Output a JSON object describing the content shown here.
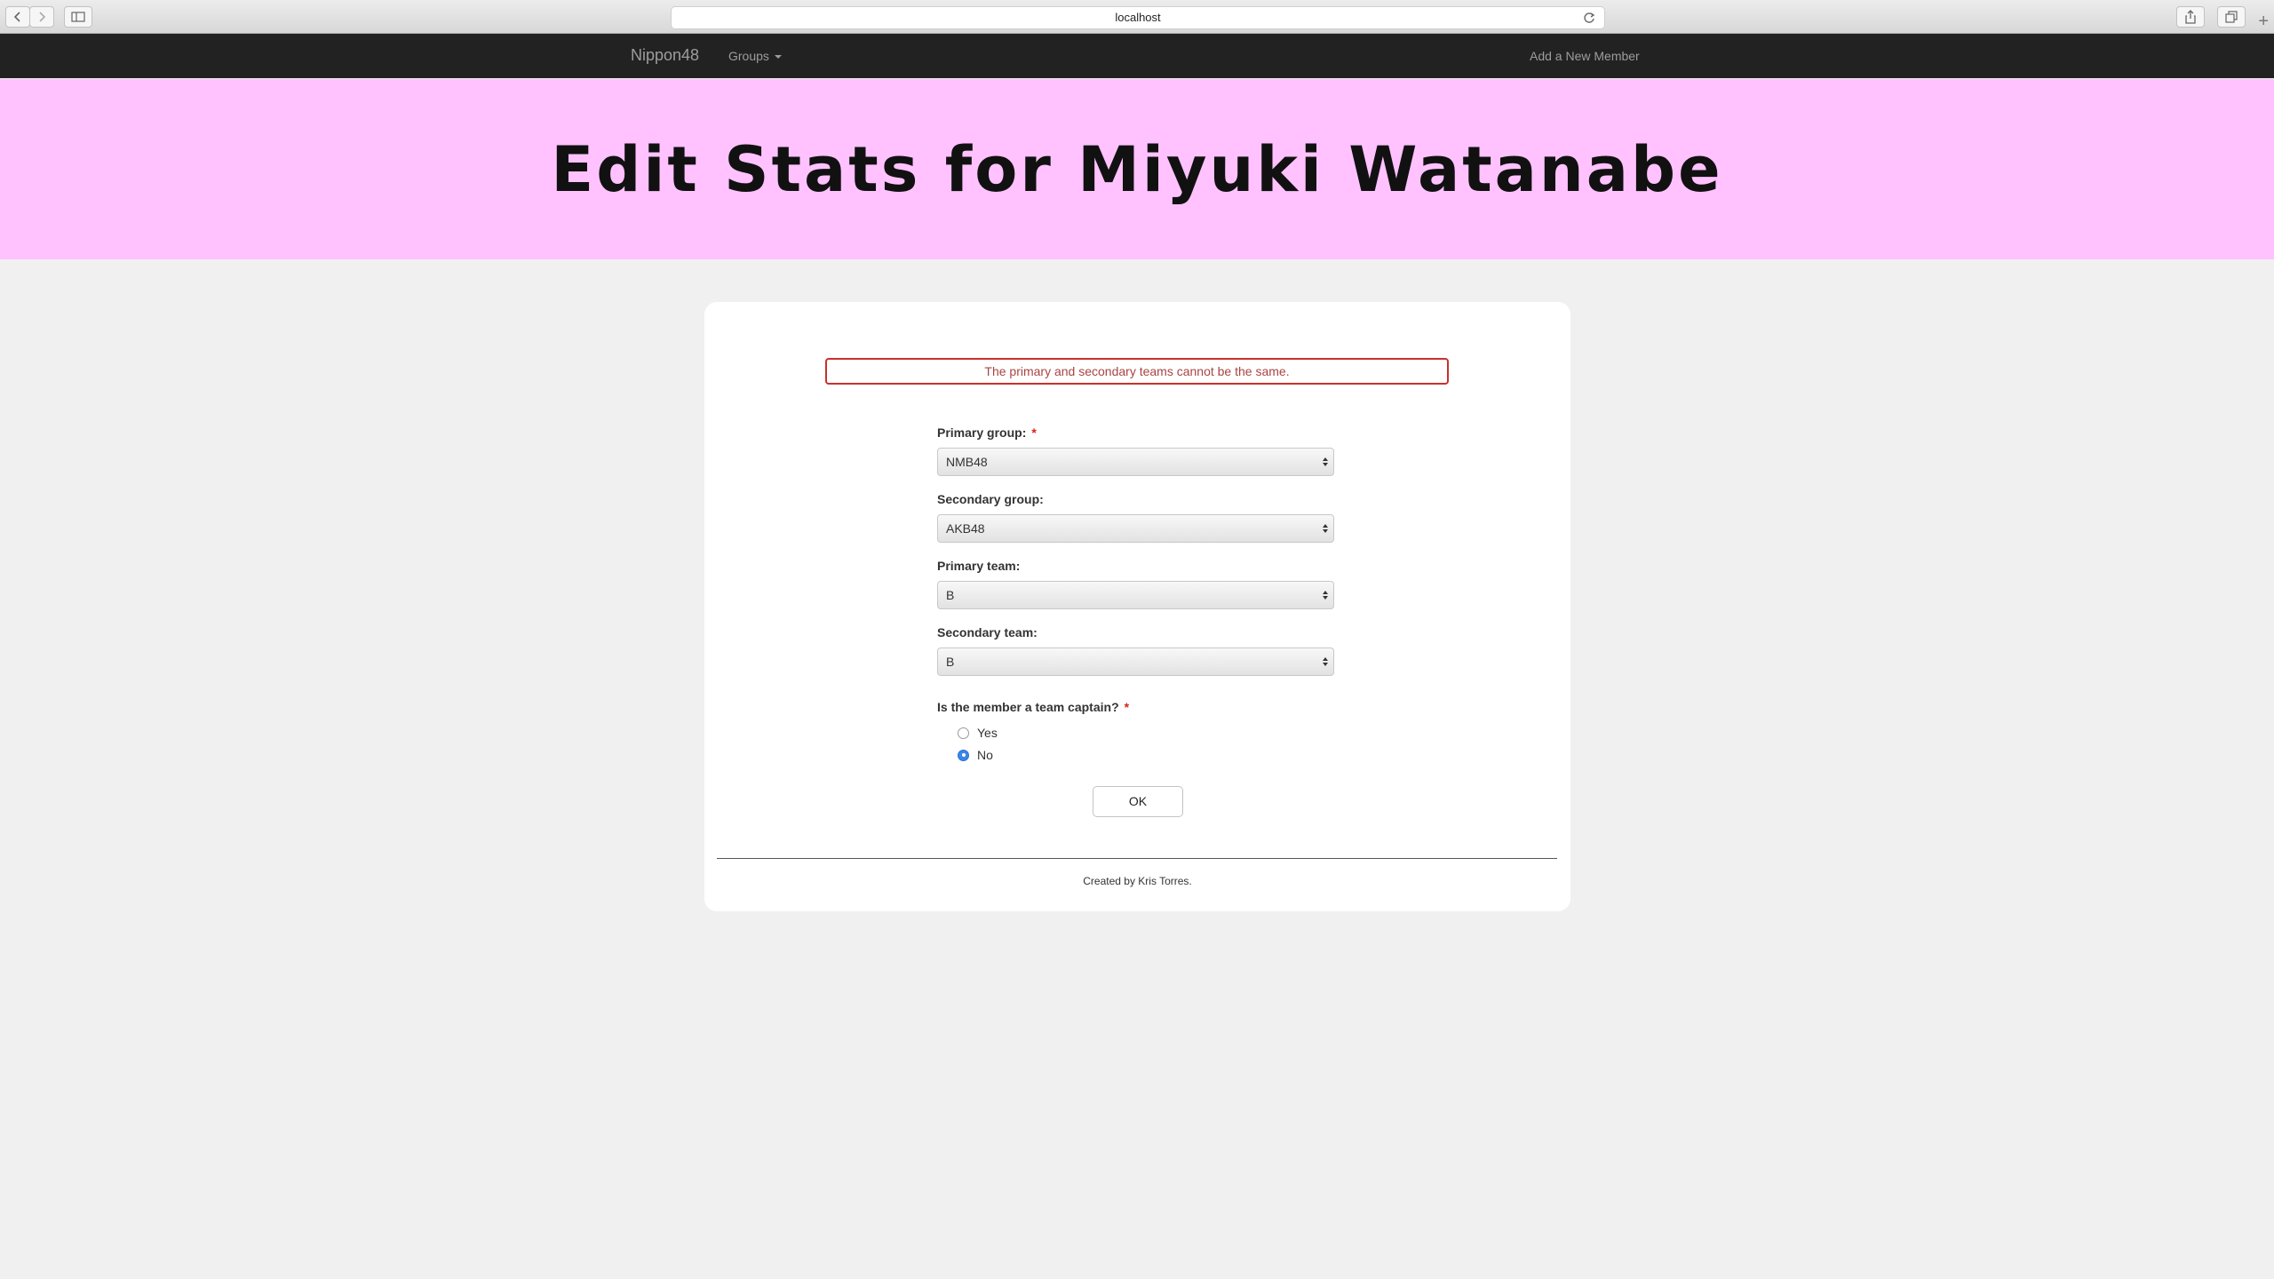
{
  "browser": {
    "url": "localhost"
  },
  "navbar": {
    "brand": "Nippon48",
    "groups_label": "Groups",
    "add_member_label": "Add a New Member"
  },
  "hero": {
    "title": "Edit Stats for Miyuki Watanabe"
  },
  "form": {
    "error_message": "The primary and secondary teams cannot be the same.",
    "primary_group": {
      "label": "Primary group:",
      "required": "*",
      "value": "NMB48"
    },
    "secondary_group": {
      "label": "Secondary group:",
      "value": "AKB48"
    },
    "primary_team": {
      "label": "Primary team:",
      "value": "B"
    },
    "secondary_team": {
      "label": "Secondary team:",
      "value": "B"
    },
    "captain": {
      "label": "Is the member a team captain?",
      "required": "*",
      "options": [
        {
          "label": "Yes",
          "checked": false
        },
        {
          "label": "No",
          "checked": true
        }
      ]
    },
    "submit_label": "OK"
  },
  "footer": {
    "text": "Created by Kris Torres."
  },
  "colors": {
    "hero_bg": "#ffc2ff",
    "navbar_bg": "#222222",
    "error": "#a94442",
    "radio_checked": "#3b87e8"
  }
}
